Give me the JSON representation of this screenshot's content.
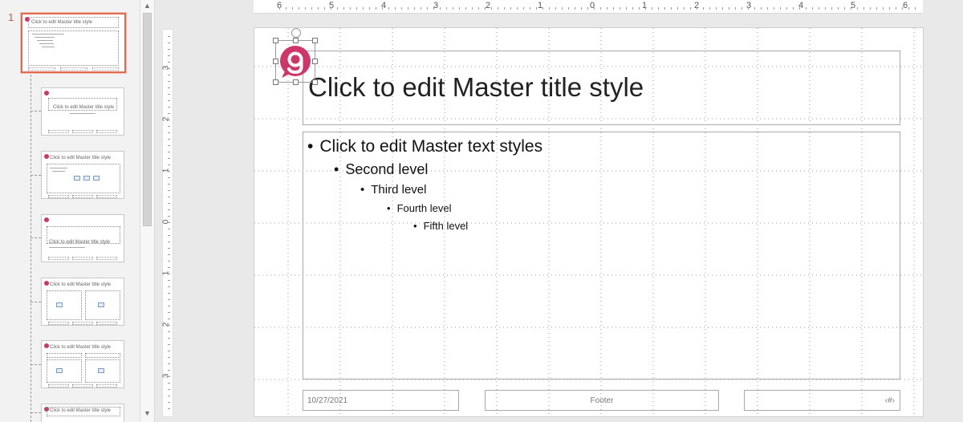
{
  "thumbnails": {
    "selected_number": "1",
    "slide1": {
      "title": "Click to edit Master title style"
    },
    "slide2": {
      "title": "Click to edit Master title style"
    },
    "slide3": {
      "title": "Click to edit Master title style"
    },
    "slide4": {
      "title": "Click to edit Master title style"
    },
    "slide5": {
      "title": "Click to edit Master title style"
    },
    "slide6": {
      "title": "Click to edit Master title style"
    },
    "slide7": {
      "title": "Click to edit Master title style"
    }
  },
  "scrollbar": {
    "up_glyph": "▲",
    "down_glyph": "▼"
  },
  "ruler_h": [
    "6",
    "5",
    "4",
    "3",
    "2",
    "1",
    "0",
    "1",
    "2",
    "3",
    "4",
    "5",
    "6"
  ],
  "ruler_v": [
    "3",
    "2",
    "1",
    "0",
    "1",
    "2",
    "3"
  ],
  "slide": {
    "title": "Click to edit Master title style",
    "levels": [
      {
        "bullet": "•",
        "text": "Click to edit Master text styles"
      },
      {
        "bullet": "•",
        "text": "Second level"
      },
      {
        "bullet": "•",
        "text": "Third level"
      },
      {
        "bullet": "•",
        "text": "Fourth level"
      },
      {
        "bullet": "•",
        "text": "Fifth level"
      }
    ],
    "date": "10/27/2021",
    "footer": "Footer",
    "slide_number": "‹#›"
  },
  "colors": {
    "logo": "#d0356a",
    "selection": "#e06a4e"
  },
  "icons": {
    "logo": "brand-g-logo-icon"
  }
}
